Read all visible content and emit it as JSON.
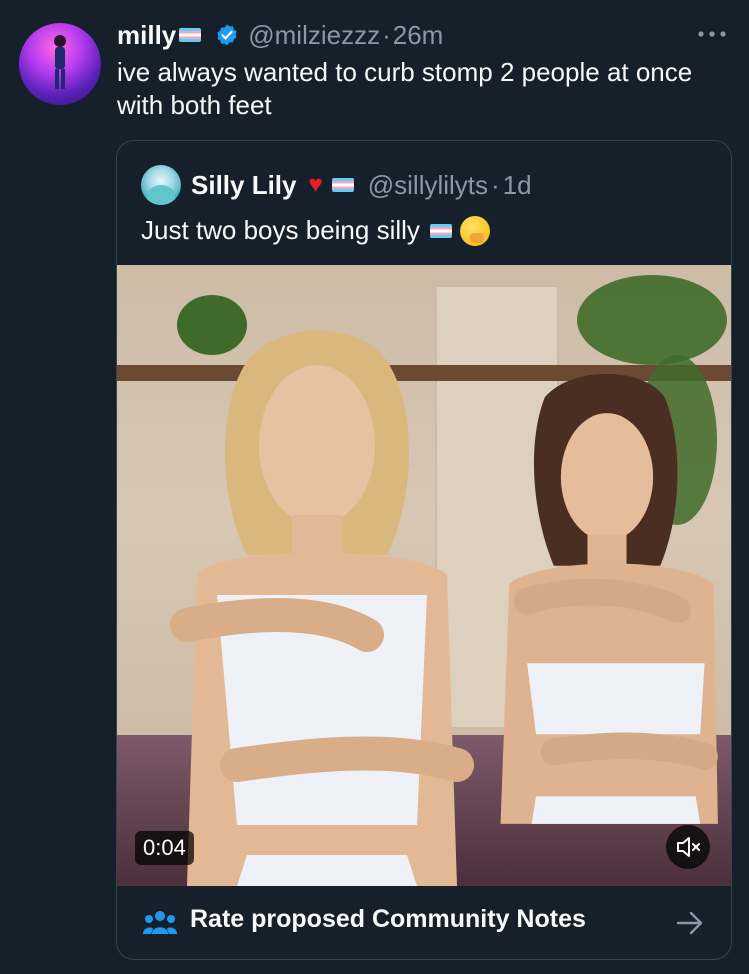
{
  "tweet": {
    "author_name": "milly",
    "handle": "@milziezzz",
    "separator": "·",
    "time": "26m",
    "text": "ive always wanted to curb stomp 2 people at once with both feet"
  },
  "quote": {
    "author_name": "Silly Lily",
    "handle": "@sillylilyts",
    "separator": "·",
    "time": "1d",
    "text": "Just two boys being silly",
    "video_duration": "0:04"
  },
  "community_notes": {
    "label": "Rate proposed Community Notes"
  },
  "icons": {
    "verified": "verified-badge-icon",
    "more": "more-options-icon",
    "mute": "mute-speaker-icon",
    "notes": "people-icon",
    "arrow": "arrow-right-icon"
  },
  "colors": {
    "background": "#15202b",
    "accent": "#1d9bf0",
    "muted_text": "#8b98a5",
    "border": "#38444d"
  }
}
